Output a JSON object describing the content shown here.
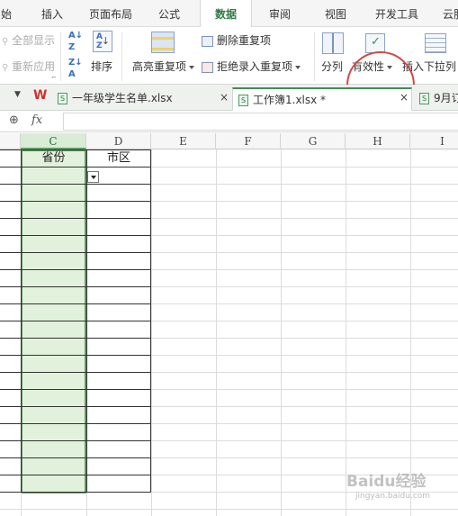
{
  "menu": {
    "tabs": [
      "始",
      "插入",
      "页面布局",
      "公式",
      "数据",
      "审阅",
      "视图",
      "开发工具",
      "云服"
    ],
    "active": "数据"
  },
  "ribbon": {
    "show_all": "全部显示",
    "reapply": "重新应用",
    "sort": "排序",
    "highlight_dup": "高亮重复项",
    "remove_dup": "删除重复项",
    "reject_dup": "拒绝录入重复项",
    "split": "分列",
    "validity": "有效性",
    "insert_dropdown": "插入下拉列"
  },
  "doc_tabs": {
    "file1": "一年级学生名单.xlsx",
    "file2": "工作簿1.xlsx *",
    "file3": "9月订"
  },
  "formula_bar": {
    "fx": "fx",
    "value": ""
  },
  "columns": [
    "C",
    "D",
    "E",
    "F",
    "G",
    "H",
    "I"
  ],
  "header_row": {
    "c": "省份",
    "d": "市区"
  },
  "watermark": {
    "text": "Baidu经验",
    "sub": "jingyan.baidu.com"
  },
  "colors": {
    "accent_green": "#2f7a43",
    "selected_column": "#e2f1dc",
    "highlight_circle": "#d24a43"
  }
}
